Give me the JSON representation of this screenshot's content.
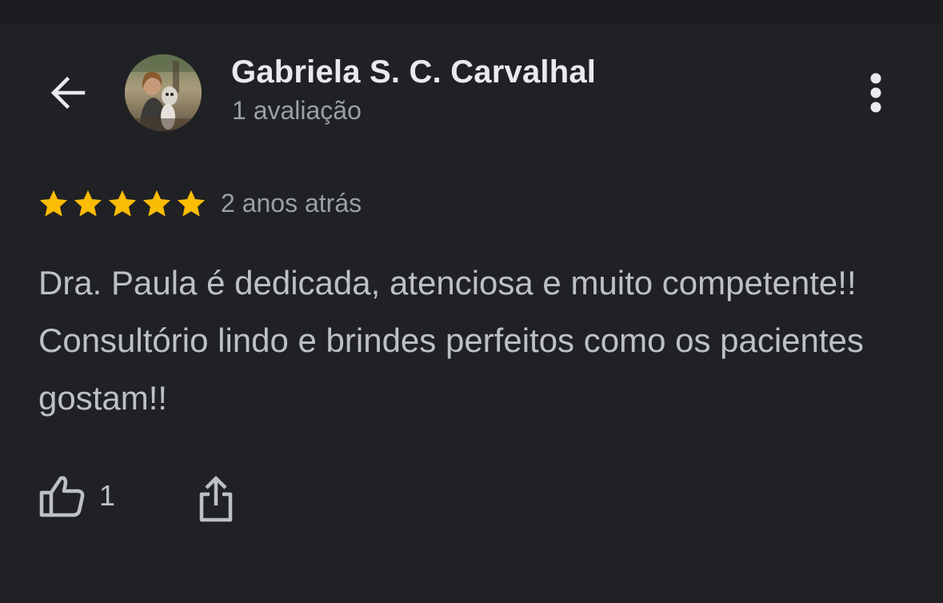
{
  "header": {
    "back_icon": "arrow-left-icon",
    "avatar_icon": "profile-photo",
    "reviewer_name": "Gabriela S. C. Carvalhal",
    "review_count": "1 avaliação",
    "menu_icon": "more-vertical-icon"
  },
  "review": {
    "rating": 5,
    "rating_max": 5,
    "star_color": "#fbbc04",
    "time_ago": "2 anos atrás",
    "text": "Dra. Paula é dedicada, atenciosa e muito competente!! Consultório lindo e brindes perfeitos como os pacientes gostam!!"
  },
  "actions": {
    "like_icon": "thumbs-up-icon",
    "like_count": "1",
    "share_icon": "share-icon"
  },
  "colors": {
    "background": "#202124",
    "primary_text": "#e8eaed",
    "secondary_text": "#9aa0a6",
    "body_text": "#bdc1c6"
  }
}
